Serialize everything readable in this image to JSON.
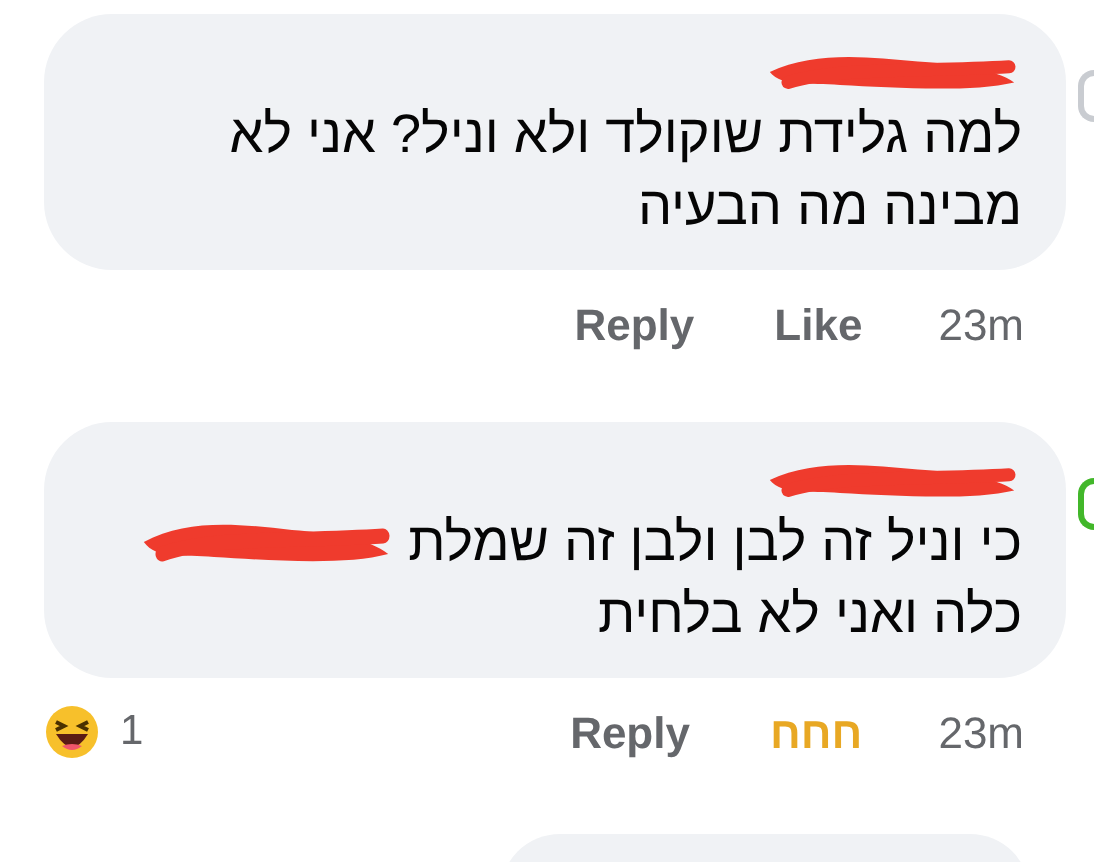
{
  "comments": [
    {
      "lines": [
        {
          "text": "למה גלידת שוקולד ולא וניל? אני לא"
        },
        {
          "text": "מבינה מה הבעיה"
        }
      ],
      "reply": "Reply",
      "like": {
        "label": "Like",
        "reacted": false
      },
      "time": "23m"
    },
    {
      "lines": [
        {
          "text": "כי וניל זה לבן ולבן זה שמלת",
          "mention_redacted": true
        },
        {
          "text": "כלה ואני לא בלחית"
        }
      ],
      "reactions_count": "1",
      "reply": "Reply",
      "like": {
        "label": "חחח",
        "reacted": true
      },
      "time": "23m"
    }
  ]
}
